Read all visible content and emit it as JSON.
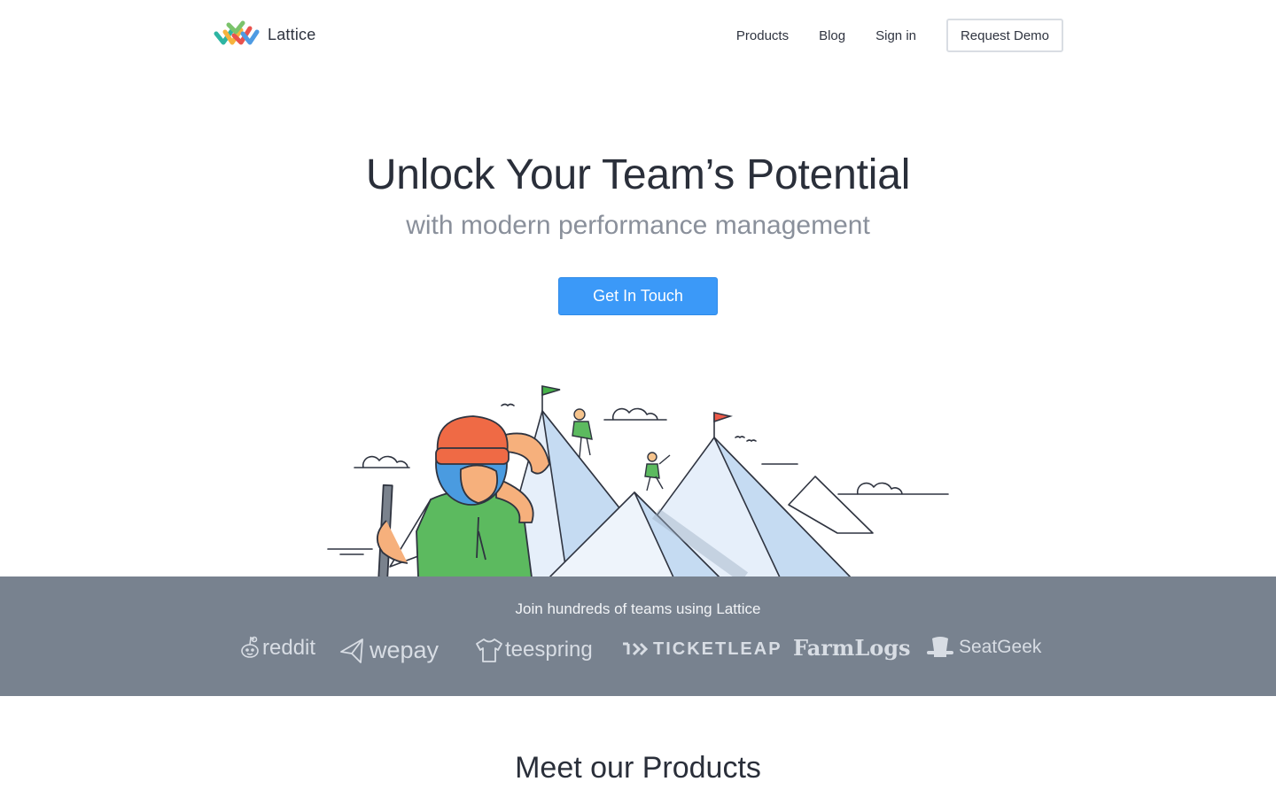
{
  "brand": {
    "name": "Lattice"
  },
  "nav": {
    "products": "Products",
    "blog": "Blog",
    "sign_in": "Sign in",
    "request_demo": "Request Demo"
  },
  "hero": {
    "title": "Unlock Your Team’s Potential",
    "subtitle": "with modern performance management",
    "cta": "Get In Touch"
  },
  "customers": {
    "heading": "Join hundreds of teams using Lattice",
    "logos": [
      "reddit",
      "wepay",
      "teespring",
      "TICKETLEAP",
      "FarmLogs",
      "SeatGeek"
    ]
  },
  "products": {
    "heading": "Meet our Products"
  },
  "colors": {
    "accent": "#3b99f8",
    "band": "#78828f",
    "text": "#2f3440",
    "muted": "#8a909b",
    "mountain": "#c5dbf2",
    "shirt": "#5cba5f",
    "beanie": "#ef6a45"
  },
  "icons": {
    "logo": "lattice-logo-icon",
    "reddit": "reddit-alien-icon",
    "wepay": "paper-plane-icon",
    "teespring": "tshirt-icon",
    "ticketleap": "chevrons-icon",
    "seatgeek": "top-hat-icon"
  }
}
